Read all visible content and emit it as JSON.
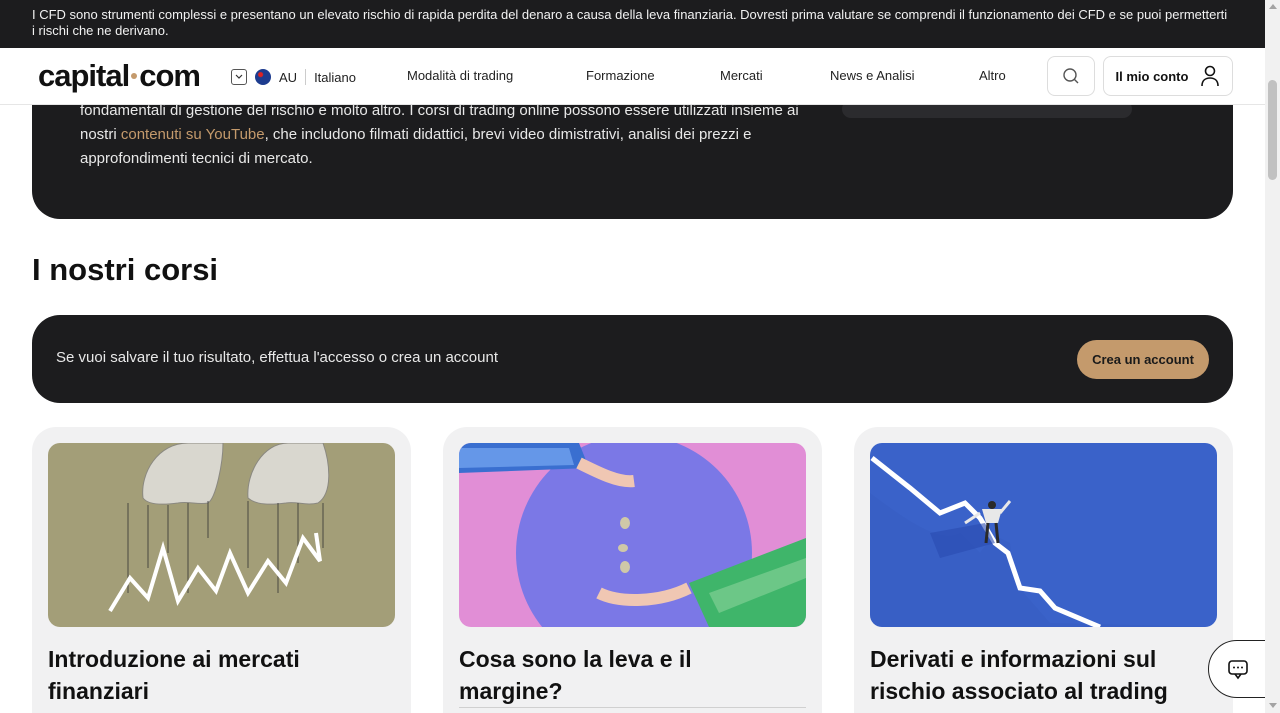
{
  "risk_banner": {
    "text": "I CFD sono strumenti complessi e presentano un elevato rischio di rapida perdita del denaro a causa della leva finanziaria. Dovresti prima valutare se comprendi il funzionamento dei CFD e se puoi permetterti i rischi che ne derivano."
  },
  "header": {
    "logo": {
      "part1": "capital",
      "part2": "com"
    },
    "region": "AU",
    "language": "Italiano",
    "nav": [
      "Modalità di trading",
      "Formazione",
      "Mercati",
      "News e Analisi",
      "Altro"
    ],
    "account_label": "Il mio conto",
    "icons": {
      "search": "search-icon",
      "account": "user-icon",
      "region_toggle": "chevron-down-icon",
      "flag": "australia-flag-icon"
    }
  },
  "hero": {
    "text_before_link": "fondamentali di gestione del rischio e molto altro. I corsi di trading online possono essere utilizzati insieme ai nostri ",
    "link": "contenuti su YouTube",
    "text_after_link": ", che includono filmati didattici, brevi video dimistrativi, analisi dei prezzi e approfondimenti tecnici di mercato."
  },
  "section_title": "I nostri corsi",
  "notice": {
    "text": "Se vuoi salvare il tuo risultato, effettua l'accesso o crea un account",
    "button": "Crea un account"
  },
  "cards": [
    {
      "title": "Introduzione ai mercati finanziari",
      "image": "puppet-hands-chart-image"
    },
    {
      "title": "Cosa sono la leva e il margine?",
      "image": "hands-coins-image"
    },
    {
      "title": "Derivati e informazioni sul rischio associato al trading",
      "image": "man-on-falling-chart-image"
    }
  ],
  "chat": {
    "icon": "chat-icon"
  },
  "colors": {
    "accent": "#c49a6c",
    "dark": "#1c1c1e",
    "card_bg": "#f1f1f2"
  }
}
